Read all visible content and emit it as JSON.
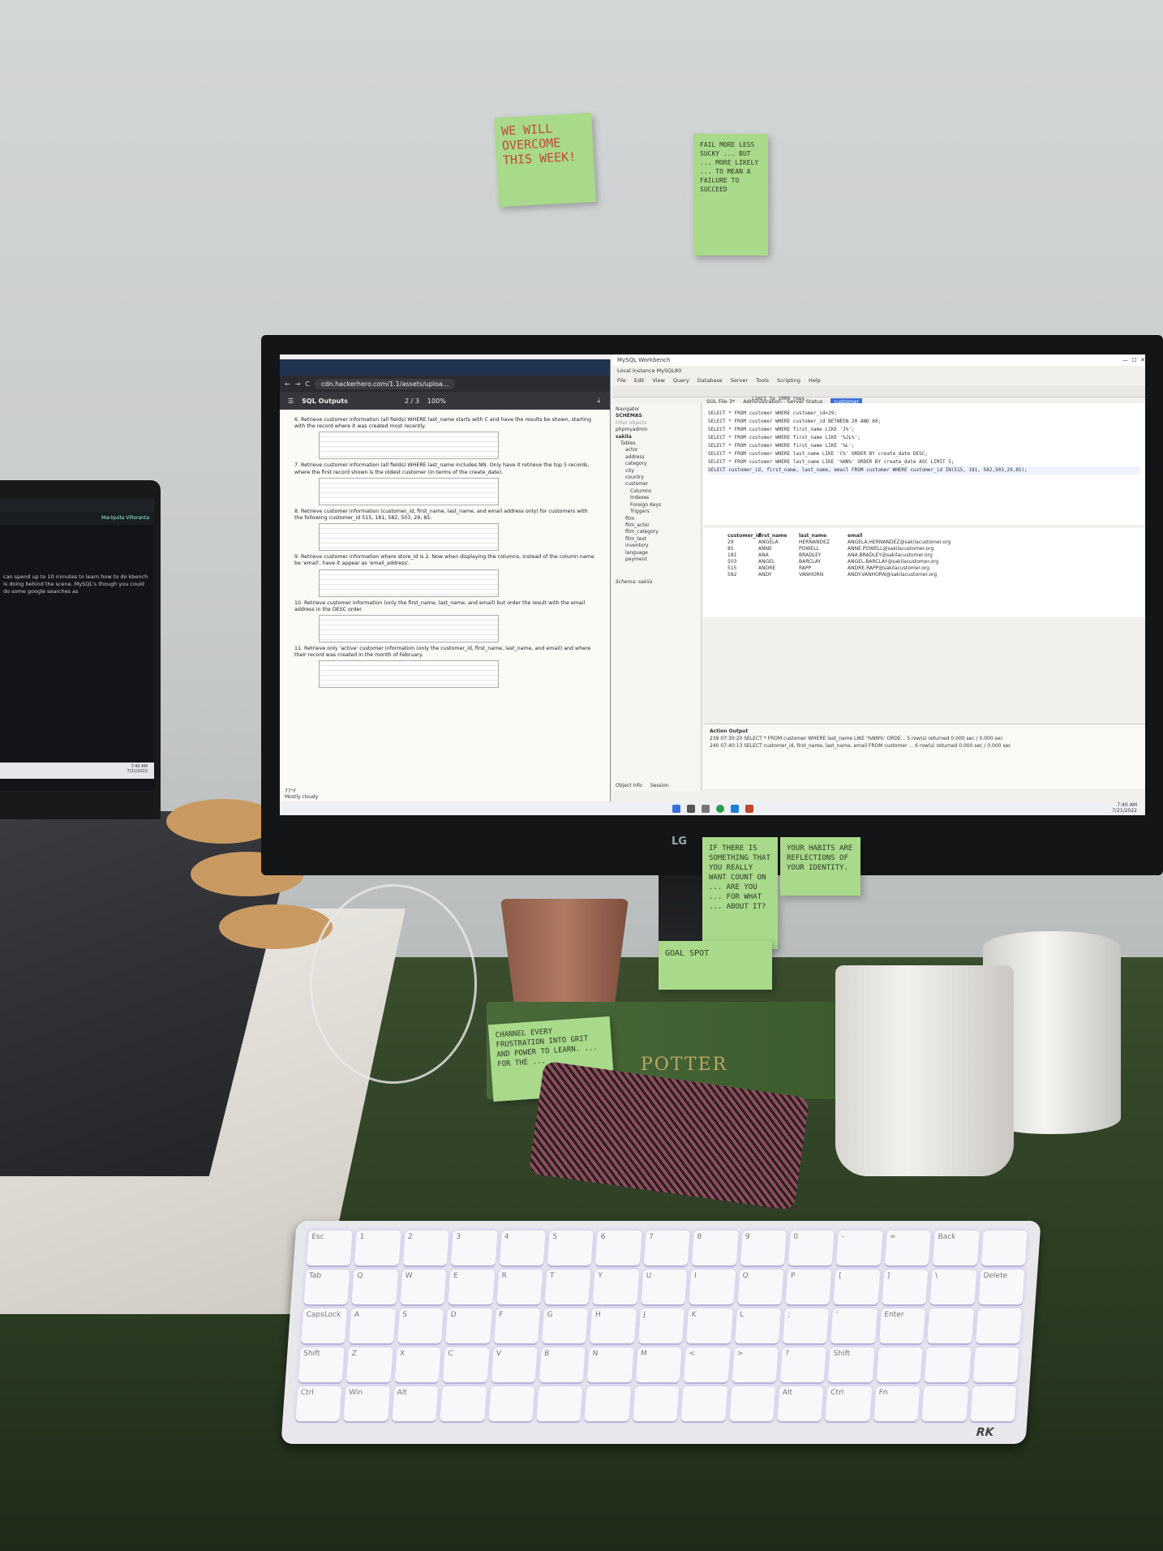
{
  "wall_notes": {
    "note1": "WE WILL OVERCOME THIS WEEK!",
    "note2": "FAIL MORE LESS SUCKY ... BUT ... MORE LIKELY ... TO MEAN A FAILURE TO SUCCEED",
    "note3": "IF THERE IS SOMETHING THAT YOU REALLY WANT COUNT ON ... ARE YOU ... FOR WHAT ... ABOUT IT?",
    "note4": "YOUR HABITS ARE REFLECTIONS OF YOUR IDENTITY.",
    "note5": "CHANNEL EVERY FRUSTRATION INTO GRIT AND POWER TO LEARN. ... FOR THE ...",
    "note6": "GOAL SPOT"
  },
  "monitor_brand": "LG",
  "chrome": {
    "address": "cdn.hackerhero.com/1.1/assets/uploa...",
    "pdf_title": "SQL Outputs",
    "pdf_page": "2 / 3",
    "pdf_zoom": "100%",
    "questions": [
      "6. Retrieve customer information (all fields) WHERE last_name starts with C and have the results be shown, starting with the record where it was created most recently.",
      "7. Retrieve customer information (all fields) WHERE last_name includes NN. Only have it retrieve the top 5 records, where the first record shown is the oldest customer (in terms of the create_date).",
      "8. Retrieve customer information (customer_id, first_name, last_name, and email address only) for customers with the following customer_id 515, 181, 582, 503, 29, 85.",
      "9. Retrieve customer information where store_id is 2. Now when displaying the columns, instead of the column name be 'email', have it appear as 'email_address'.",
      "10. Retrieve customer information (only the first_name, last_name, and email) but order the result with the email address in the DESC order.",
      "11. Retrieve only 'active' customer information (only the customer_id, first_name, last_name, and email) and where their record was created in the month of February."
    ],
    "weather": "77°F",
    "weather_desc": "Mostly cloudy"
  },
  "workbench": {
    "title": "MySQL Workbench",
    "instance": "Local instance MySQL80",
    "menu": [
      "File",
      "Edit",
      "View",
      "Query",
      "Database",
      "Server",
      "Tools",
      "Scripting",
      "Help"
    ],
    "tabs": [
      "SQL File 3*",
      "Administration - Server Status",
      "customer"
    ],
    "navigator_title": "Navigator",
    "schemas_label": "SCHEMAS",
    "filter_placeholder": "Filter objects",
    "schemas": [
      "phpmyadmin",
      "sakila",
      "Tables",
      "actor",
      "address",
      "category",
      "city",
      "country",
      "customer",
      "Columns",
      "Indexes",
      "Foreign Keys",
      "Triggers",
      "film",
      "film_actor",
      "film_category",
      "film_text",
      "inventory",
      "language",
      "payment"
    ],
    "schema_info": "Schema: sakila",
    "limit": "Limit to 1000 rows",
    "queries": [
      "SELECT * FROM customer WHERE customer_id=29;",
      "SELECT * FROM customer WHERE customer_id BETWEEN 20 AND 60;",
      "SELECT * FROM customer WHERE first_name LIKE 'J%';",
      "SELECT * FROM customer WHERE first_name LIKE '%JL%';",
      "SELECT * FROM customer WHERE first_name LIKE '%L';",
      "SELECT * FROM customer WHERE last_name LIKE 'C%' ORDER BY create_date DESC;",
      "SELECT * FROM customer WHERE last_name LIKE '%NN%' ORDER BY create_date ASC LIMIT 5;",
      "SELECT customer_id, first_name, last_name, email FROM customer WHERE customer_id IN(515, 181, 582,503,29,85);"
    ],
    "result_headers": [
      "customer_id",
      "first_name",
      "last_name",
      "email"
    ],
    "result_rows": [
      [
        "29",
        "ANGELA",
        "HERNANDEZ",
        "ANGELA.HERNANDEZ@sakilacustomer.org"
      ],
      [
        "85",
        "ANNE",
        "POWELL",
        "ANNE.POWELL@sakilacustomer.org"
      ],
      [
        "181",
        "ANA",
        "BRADLEY",
        "ANA.BRADLEY@sakilacustomer.org"
      ],
      [
        "503",
        "ANGEL",
        "BARCLAY",
        "ANGEL.BARCLAY@sakilacustomer.org"
      ],
      [
        "515",
        "ANDRE",
        "RAPP",
        "ANDRE.RAPP@sakilacustomer.org"
      ],
      [
        "582",
        "ANDY",
        "VANHORN",
        "ANDY.VANHORN@sakilacustomer.org"
      ]
    ],
    "output_label": "Action Output",
    "output_rows": [
      "239  07:30:20  SELECT * FROM customer WHERE last_name LIKE '%NN%' ORDE...  5 row(s) returned  0.000 sec / 0.000 sec",
      "240  07:40:13  SELECT customer_id, first_name, last_name, email FROM customer ...  6 row(s) returned  0.000 sec / 0.000 sec"
    ],
    "bottom_tabs": [
      "Object Info",
      "Session"
    ],
    "clock_time": "7:40 AM",
    "clock_date": "7/21/2022"
  },
  "laptop": {
    "user": "Mariquita Villoranta",
    "text": "can spend up to 10 minutes to learn how to do kbench is doing behind the scene. MySQL's though you could do some google searches as",
    "time": "7:40 AM",
    "date": "7/21/2022"
  },
  "book_title": "POTTER",
  "keyboard_brand": "RK",
  "keyboard_rows": [
    [
      "Esc",
      "1",
      "2",
      "3",
      "4",
      "5",
      "6",
      "7",
      "8",
      "9",
      "0",
      "-",
      "=",
      "Back",
      ""
    ],
    [
      "Tab",
      "Q",
      "W",
      "E",
      "R",
      "T",
      "Y",
      "U",
      "I",
      "O",
      "P",
      "[",
      "]",
      "\\",
      "Delete"
    ],
    [
      "CapsLock",
      "A",
      "S",
      "D",
      "F",
      "G",
      "H",
      "J",
      "K",
      "L",
      ";",
      "'",
      "Enter",
      "",
      ""
    ],
    [
      "Shift",
      "Z",
      "X",
      "C",
      "V",
      "B",
      "N",
      "M",
      "<",
      ">",
      "?",
      "Shift",
      "",
      "",
      ""
    ],
    [
      "Ctrl",
      "Win",
      "Alt",
      "",
      "",
      "",
      "",
      "",
      "",
      "",
      "Alt",
      "Ctrl",
      "Fn",
      "",
      ""
    ]
  ]
}
